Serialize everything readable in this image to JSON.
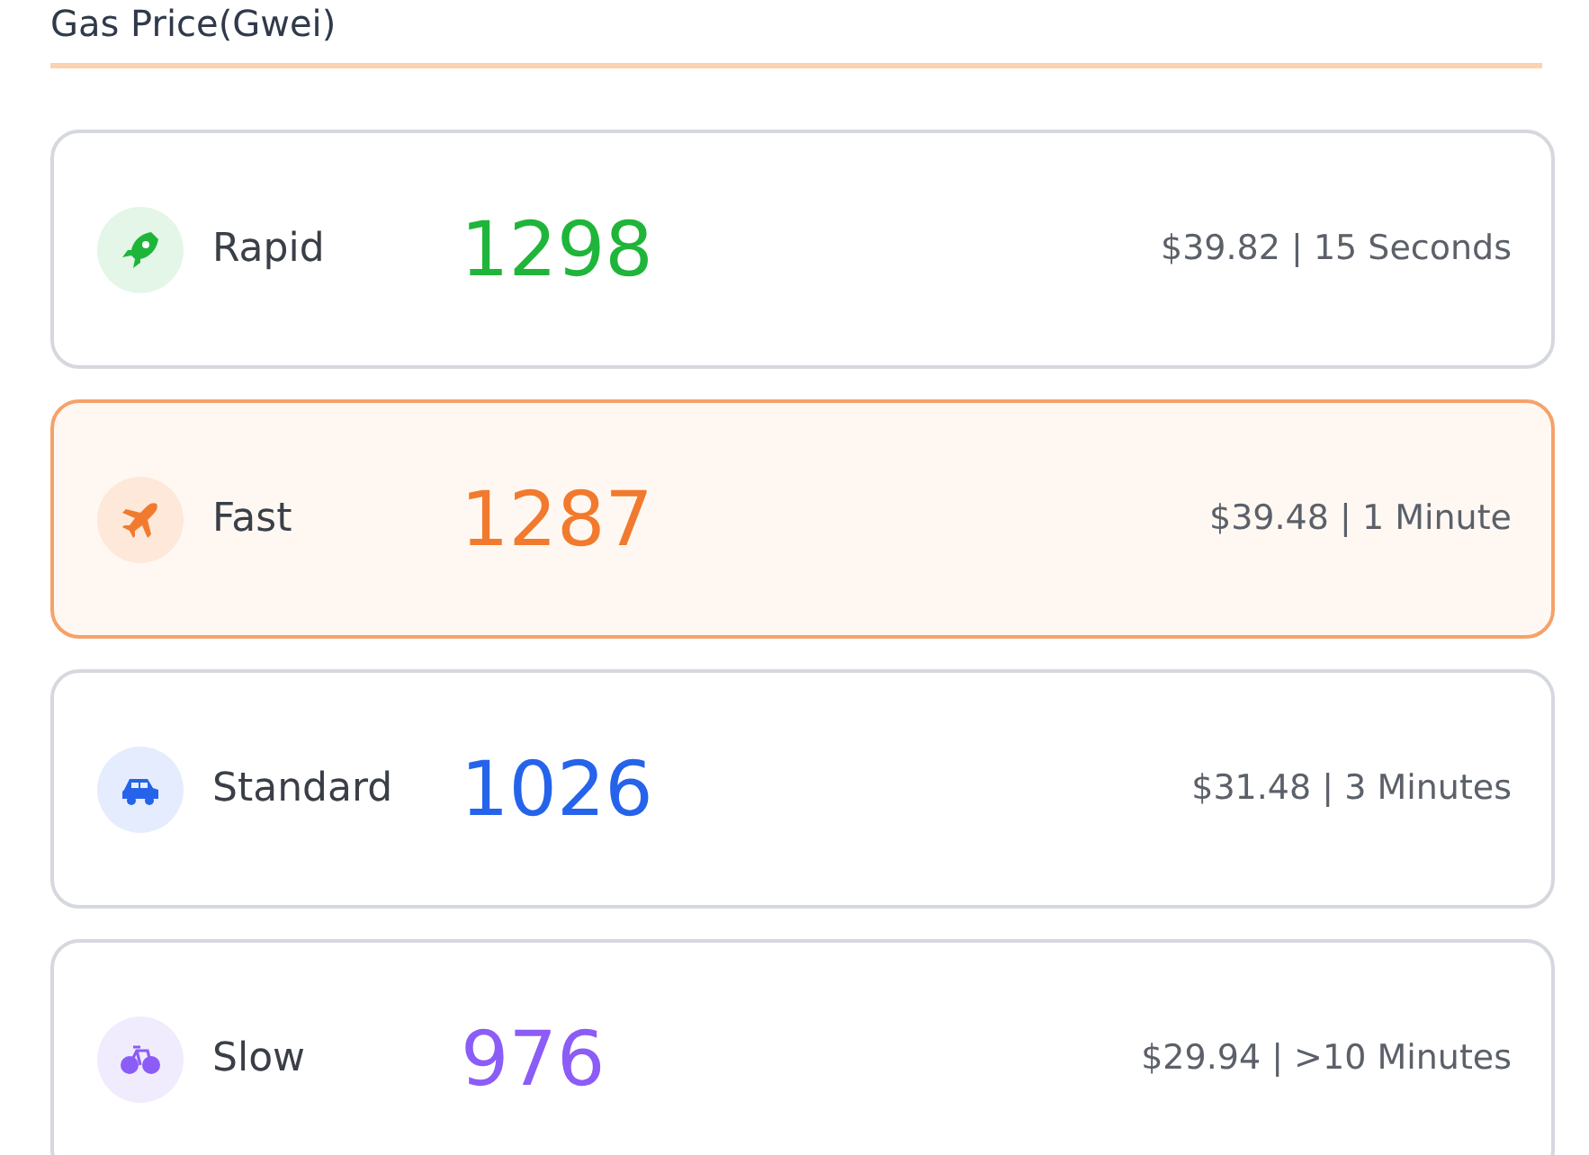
{
  "title": "Gas Price(Gwei)",
  "levels": [
    {
      "kind": "rocket",
      "label": "Rapid",
      "value": "1298",
      "color": "#1fb53a",
      "detail": "$39.82 | 15 Seconds",
      "selected": false
    },
    {
      "kind": "plane",
      "label": "Fast",
      "value": "1287",
      "color": "#f27a2e",
      "detail": "$39.48 | 1 Minute",
      "selected": true
    },
    {
      "kind": "car",
      "label": "Standard",
      "value": "1026",
      "color": "#2563eb",
      "detail": "$31.48 | 3 Minutes",
      "selected": false
    },
    {
      "kind": "bike",
      "label": "Slow",
      "value": "976",
      "color": "#8b5cf6",
      "detail": "$29.94 | >10 Minutes",
      "selected": false
    }
  ]
}
